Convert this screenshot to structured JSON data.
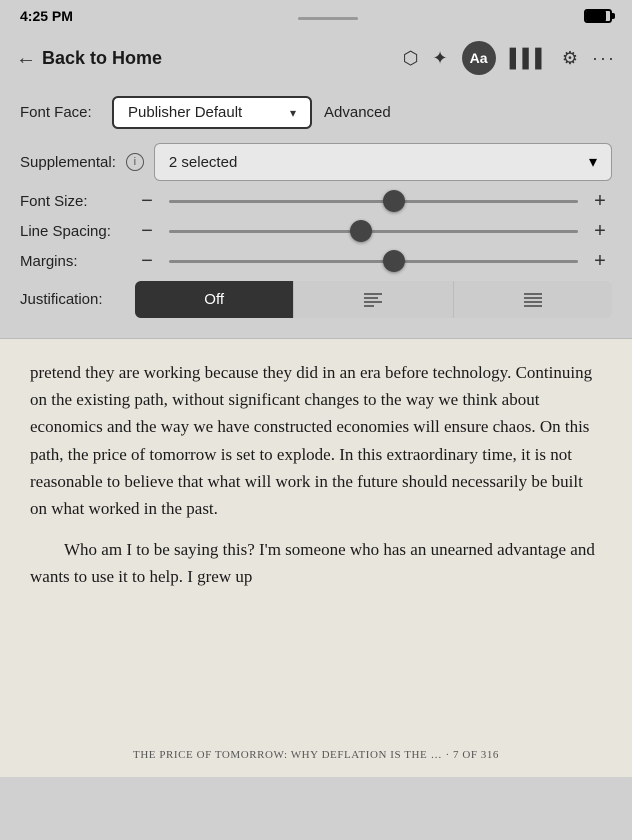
{
  "status": {
    "time": "4:25 PM",
    "battery_level": 85
  },
  "nav": {
    "back_label": "Back to Home",
    "icons": {
      "bookmark": "🔖",
      "brightness": "☀",
      "font": "Aa",
      "chart": "📊",
      "settings": "⚙",
      "more": "···"
    }
  },
  "settings": {
    "font_face_label": "Font Face:",
    "font_face_value": "Publisher Default",
    "advanced_label": "Advanced",
    "supplemental_label": "Supplemental:",
    "supplemental_value": "2 selected",
    "font_size_label": "Font Size:",
    "font_size_thumb_pct": 55,
    "line_spacing_label": "Line Spacing:",
    "line_spacing_thumb_pct": 47,
    "margins_label": "Margins:",
    "margins_thumb_pct": 55,
    "justification_label": "Justification:",
    "justification_options": [
      "Off",
      "≡",
      "≡"
    ],
    "justification_active": 0,
    "minus_label": "−",
    "plus_label": "+"
  },
  "book": {
    "paragraph1": "pretend they are working because they did in an era before technology. Continuing on the existing path, without significant changes to the way we think about economics and the way we have constructed economies will ensure chaos. On this path, the price of tomorrow is set to explode. In this extraordinary time, it is not reasonable to believe that what will work in the future should necessarily be built on what worked in the past.",
    "paragraph2": "Who am I to be saying this? I'm someone who has an unearned advantage and wants to use it to help. I grew up",
    "footer": "THE PRICE OF TOMORROW: WHY DEFLATION IS THE … · 7 OF 316"
  }
}
